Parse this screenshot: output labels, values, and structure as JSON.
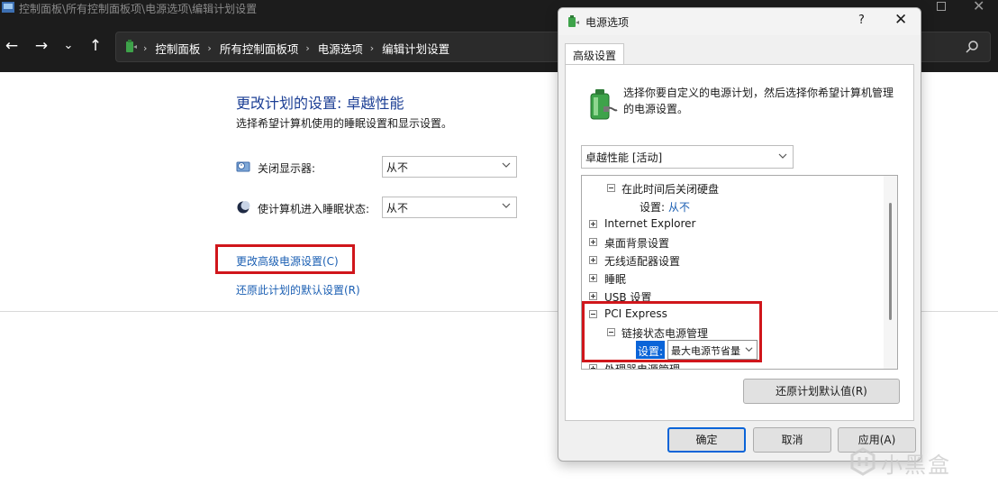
{
  "explorer": {
    "title": "控制面板\\所有控制面板项\\电源选项\\编辑计划设置",
    "breadcrumbs": [
      "控制面板",
      "所有控制面板项",
      "电源选项",
      "编辑计划设置"
    ],
    "plan_title": "更改计划的设置: 卓越性能",
    "plan_desc": "选择希望计算机使用的睡眠设置和显示设置。",
    "display_off_label": "关闭显示器:",
    "display_off_value": "从不",
    "sleep_label": "使计算机进入睡眠状态:",
    "sleep_value": "从不",
    "advanced_link": "更改高级电源设置(C)",
    "restore_link": "还原此计划的默认设置(R)"
  },
  "dialog": {
    "title": "电源选项",
    "help": "?",
    "close": "✕",
    "tab": "高级设置",
    "intro_line1": "选择你要自定义的电源计划，然后选择你希望计算机管理",
    "intro_line2": "的电源设置。",
    "plan_select": "卓越性能 [活动]",
    "tree": {
      "harddisk": "在此时间后关闭硬盘",
      "harddisk_setting_label": "设置:",
      "harddisk_setting_value": "从不",
      "ie": "Internet Explorer",
      "desktop": "桌面背景设置",
      "wireless": "无线适配器设置",
      "sleep": "睡眠",
      "usb": "USB 设置",
      "pci": "PCI Express",
      "link_state": "链接状态电源管理",
      "setting_label": "设置:",
      "setting_value": "最大电源节省量",
      "processor": "处理器电源管理"
    },
    "restore_button": "还原计划默认值(R)",
    "ok_button": "确定",
    "cancel_button": "取消",
    "apply_button": "应用(A)"
  },
  "watermark": "小黑盒",
  "colors": {
    "accent": "#0a64d8",
    "link": "#1b5fb3",
    "highlight_box": "#d0161b",
    "titlebar": "#1c1c1c"
  }
}
